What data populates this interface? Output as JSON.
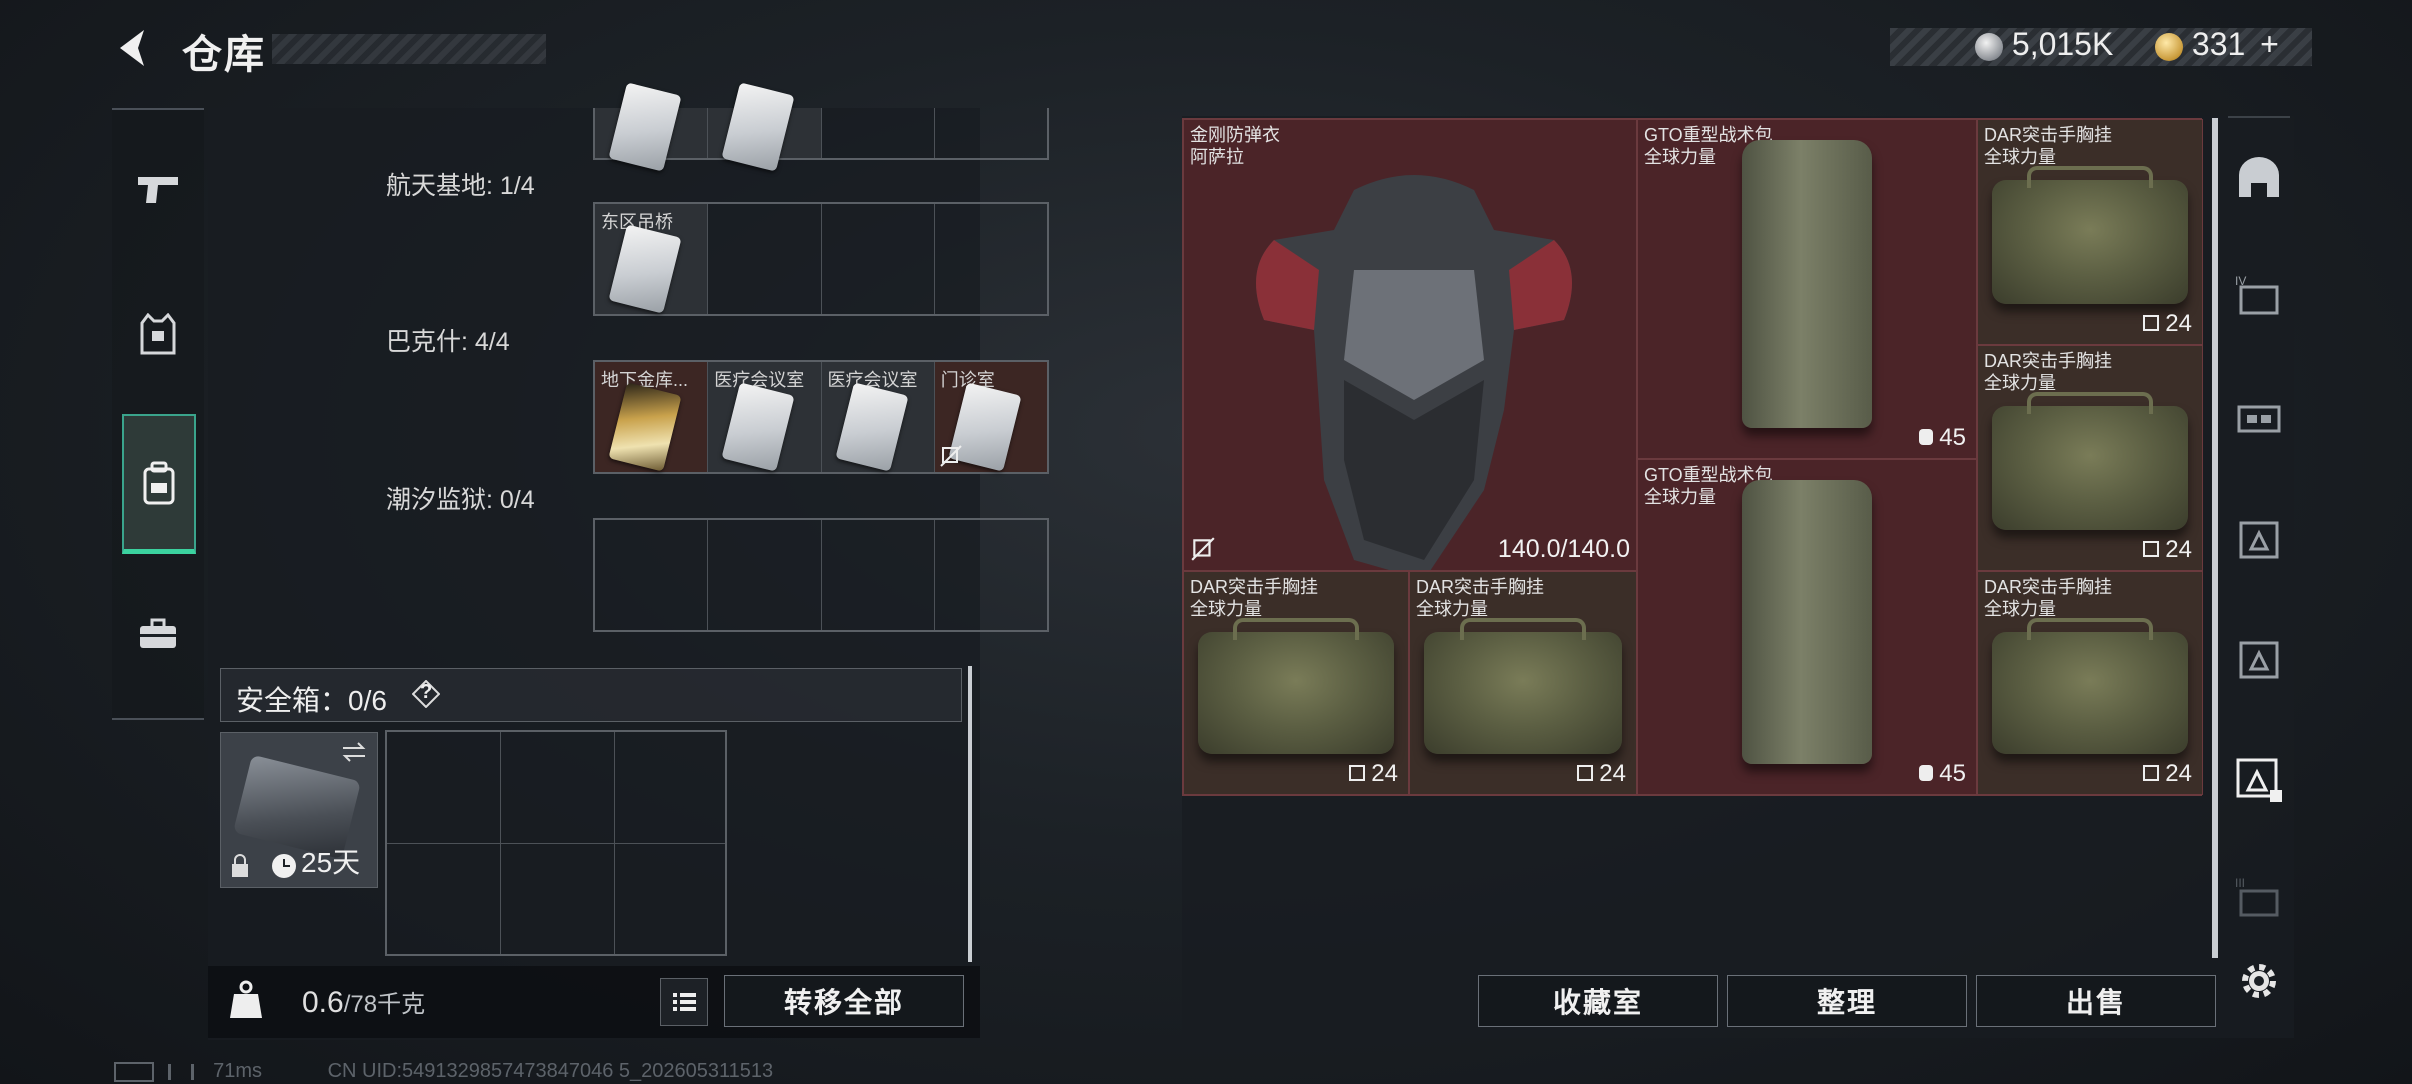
{
  "header": {
    "title": "仓库",
    "currency1": "5,015K",
    "currency2": "331",
    "currency2_add": "+"
  },
  "left_nav": {
    "items": [
      {
        "icon": "gun-icon"
      },
      {
        "icon": "vest-icon"
      },
      {
        "icon": "backpack-icon",
        "active": true
      },
      {
        "icon": "briefcase-icon"
      }
    ]
  },
  "keycards": {
    "groups": [
      {
        "label": "航天基地: 1/4",
        "slots": [
          {
            "name": "东区吊桥",
            "filled": true
          },
          {
            "name": "",
            "filled": false
          },
          {
            "name": "",
            "filled": false
          },
          {
            "name": "",
            "filled": false
          }
        ]
      },
      {
        "label": "巴克什: 4/4",
        "slots": [
          {
            "name": "地下金库...",
            "filled": true,
            "gold": true
          },
          {
            "name": "医疗会议室",
            "filled": true
          },
          {
            "name": "医疗会议室",
            "filled": true
          },
          {
            "name": "门诊室",
            "filled": true
          }
        ]
      },
      {
        "label": "潮汐监狱: 0/4",
        "slots": [
          {
            "name": "",
            "filled": false
          },
          {
            "name": "",
            "filled": false
          },
          {
            "name": "",
            "filled": false
          },
          {
            "name": "",
            "filled": false
          }
        ]
      }
    ]
  },
  "safe_box": {
    "label": "安全箱：0/6",
    "help": "?",
    "days": "25天"
  },
  "weight": {
    "current": "0.6",
    "max": "/78千克"
  },
  "buttons": {
    "transfer_all": "转移全部",
    "collection": "收藏室",
    "sort": "整理",
    "sell": "出售"
  },
  "status_bar": {
    "ping": "71ms",
    "uid": "CN UID:5491329857473847046 5_202605311513"
  },
  "stash_items": [
    {
      "name": "金刚防弹衣\n阿萨拉",
      "value": "140.0/140.0",
      "kind": "armor"
    },
    {
      "name": "GTO重型战术包\n全球力量",
      "value": "45",
      "kind": "pack"
    },
    {
      "name": "DAR突击手胸挂\n全球力量",
      "value": "24",
      "kind": "rig"
    },
    {
      "name": "DAR突击手胸挂\n全球力量",
      "value": "24",
      "kind": "rig"
    },
    {
      "name": "GTO重型战术包\n全球力量",
      "value": "45",
      "kind": "pack"
    },
    {
      "name": "DAR突击手胸挂\n全球力量",
      "value": "24",
      "kind": "rig"
    },
    {
      "name": "DAR突击手胸挂\n全球力量",
      "value": "24",
      "kind": "rig"
    },
    {
      "name": "DAR突击手胸挂\n全球力量",
      "value": "24",
      "kind": "rig"
    }
  ],
  "right_nav": {
    "items": [
      "helmet-icon",
      "armor-rig-icon",
      "rig-icon",
      "backpack-slot-icon",
      "storage-icon",
      "storage-active-icon",
      "storage-locked-icon",
      "settings-icon"
    ]
  }
}
